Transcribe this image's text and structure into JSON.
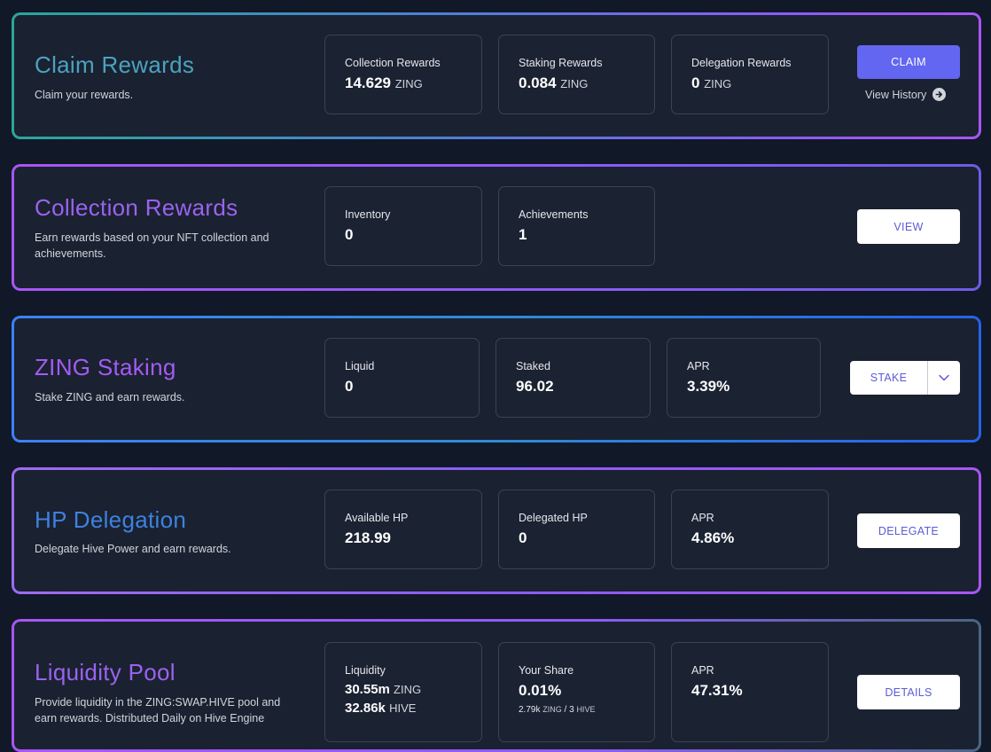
{
  "claim": {
    "title": "Claim Rewards",
    "description": "Claim your rewards.",
    "stats": [
      {
        "label": "Collection Rewards",
        "value": "14.629",
        "unit": "ZING"
      },
      {
        "label": "Staking Rewards",
        "value": "0.084",
        "unit": "ZING"
      },
      {
        "label": "Delegation Rewards",
        "value": "0",
        "unit": "ZING"
      }
    ],
    "button": "CLAIM",
    "history_link": "View History",
    "history_icon": "arrow-circle-right-icon"
  },
  "collection": {
    "title": "Collection Rewards",
    "description": "Earn rewards based on your NFT collection and achievements.",
    "stats": [
      {
        "label": "Inventory",
        "value": "0"
      },
      {
        "label": "Achievements",
        "value": "1"
      }
    ],
    "button": "VIEW"
  },
  "staking": {
    "title": "ZING Staking",
    "description": "Stake ZING and earn rewards.",
    "stats": [
      {
        "label": "Liquid",
        "value": "0"
      },
      {
        "label": "Staked",
        "value": "96.02"
      },
      {
        "label": "APR",
        "value": "3.39%"
      }
    ],
    "button": "STAKE",
    "dropdown_icon": "chevron-down-icon"
  },
  "delegation": {
    "title": "HP Delegation",
    "description": "Delegate Hive Power and earn rewards.",
    "stats": [
      {
        "label": "Available HP",
        "value": "218.99"
      },
      {
        "label": "Delegated HP",
        "value": "0"
      },
      {
        "label": "APR",
        "value": "4.86%"
      }
    ],
    "button": "DELEGATE"
  },
  "pool": {
    "title": "Liquidity Pool",
    "description": "Provide liquidity in the ZING:SWAP.HIVE pool and earn rewards. Distributed Daily on Hive Engine",
    "liquidity": {
      "label": "Liquidity",
      "zing_value": "30.55m",
      "zing_unit": "ZING",
      "hive_value": "32.86k",
      "hive_unit": "HIVE"
    },
    "share": {
      "label": "Your Share",
      "value": "0.01%",
      "zing_value": "2.79k",
      "zing_unit": "ZING",
      "separator": "/",
      "hive_value": "3",
      "hive_unit": "HIVE"
    },
    "apr": {
      "label": "APR",
      "value": "47.31%"
    },
    "button": "DETAILS"
  },
  "colors": {
    "background": "#111827",
    "card": "#1a2130",
    "accent_button": "#6366f1",
    "button_text": "#5b5bd6"
  }
}
